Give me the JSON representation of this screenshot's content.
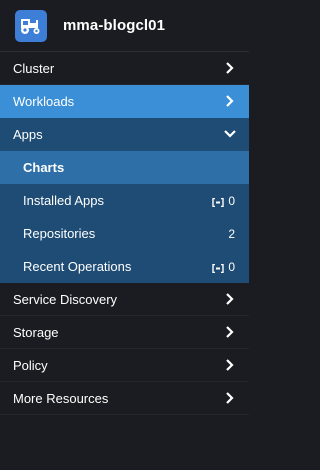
{
  "header": {
    "cluster_name": "mma-blogcl01"
  },
  "nav": {
    "cluster": "Cluster",
    "workloads": "Workloads",
    "apps": "Apps",
    "service_discovery": "Service Discovery",
    "storage": "Storage",
    "policy": "Policy",
    "more_resources": "More Resources"
  },
  "apps_submenu": {
    "charts": "Charts",
    "installed_apps": "Installed Apps",
    "installed_apps_count": "0",
    "repositories": "Repositories",
    "repositories_count": "2",
    "recent_operations": "Recent Operations",
    "recent_operations_count": "0"
  },
  "colors": {
    "background": "#1b1c21",
    "workloads_highlight": "#3a8fd6",
    "apps_group": "#1e4c74",
    "selected_item": "#2f6fa8",
    "logo": "#3d7ed6"
  },
  "icons": {
    "logo": "tractor-icon",
    "chevron_right": "chevron-right-icon",
    "chevron_down": "chevron-down-icon",
    "badge": "bracket-dot-icon"
  }
}
